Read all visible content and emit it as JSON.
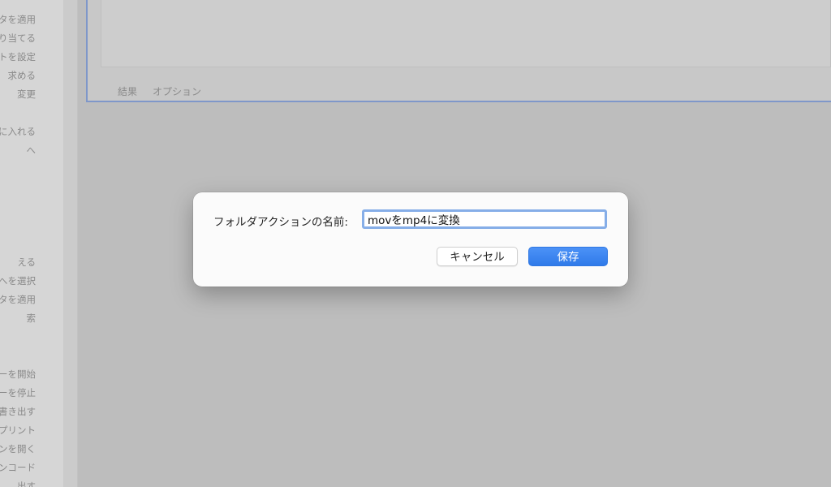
{
  "sidebar": {
    "items": [
      "タを適用",
      "り当てる",
      "ントを設定",
      "求める",
      "変更",
      "に入れる",
      "へ",
      "える",
      "へを選択",
      "タを適用",
      "索",
      "ーを開始",
      "ーを停止",
      "書き出す",
      "プリント",
      "ンを開く",
      "エンコード",
      "出す"
    ]
  },
  "workflow": {
    "tabs": [
      "結果",
      "オプション"
    ]
  },
  "dialog": {
    "label": "フォルダアクションの名前:",
    "input_value": "movをmp4に変換",
    "cancel_label": "キャンセル",
    "save_label": "保存"
  },
  "colors": {
    "accent": "#3a85f2",
    "focus_ring": "#86aee8",
    "selection_border": "#7f97c9"
  }
}
